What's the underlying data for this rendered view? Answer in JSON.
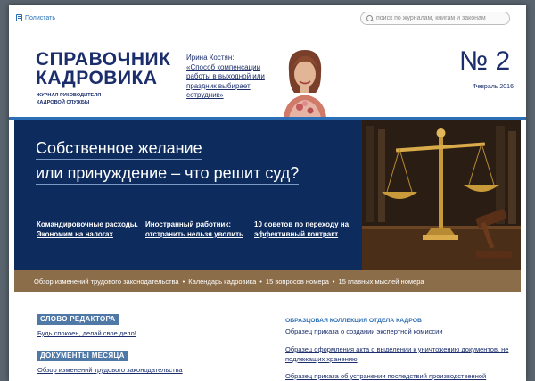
{
  "toolbar": {
    "leaf_label": "Полистать",
    "search_placeholder": "поиск по журналам, книгам и законам"
  },
  "masthead": {
    "title_line1": "СПРАВОЧНИК",
    "title_line2": "КАДРОВИКА",
    "subtitle_line1": "ЖУРНАЛ РУКОВОДИТЕЛЯ",
    "subtitle_line2": "КАДРОВОЙ СЛУЖБЫ",
    "author_name": "Ирина Костян:",
    "author_teaser": "«Способ компенсации работы в выходной или праздник выбирает сотрудник»",
    "issue_number": "№ 2",
    "issue_date": "Февраль 2016"
  },
  "hero": {
    "headline_line1": "Собственное желание",
    "headline_line2": "или принуждение – что решит суд?",
    "links": [
      {
        "text": "Командировочные расходы. Экономим на налогах"
      },
      {
        "text": "Иностранный работник: отстранить нельзя уволить"
      },
      {
        "text": "10 советов по переходу на эффективный контракт"
      }
    ]
  },
  "ticker": {
    "items": [
      "Обзор изменений трудового законодательства",
      "Календарь кадровика",
      "15 вопросов номера",
      "15 главных мыслей номера"
    ],
    "separator": "•"
  },
  "sections": {
    "editor_title": "СЛОВО РЕДАКТОРА",
    "editor_link": "Будь спокоен, делай свое дело!",
    "docs_title": "ДОКУМЕНТЫ МЕСЯЦА",
    "docs_link": "Обзор изменений трудового законодательства"
  },
  "collection": {
    "title": "ОБРАЗЦОВАЯ КОЛЛЕКЦИЯ ОТДЕЛА КАДРОВ",
    "items": [
      "Образец приказа о создании экспертной комиссии",
      "Образец оформления акта о выделении к уничтожению документов, не подлежащих хранению",
      "Образец приказа об устранении последствий производственной"
    ]
  },
  "colors": {
    "brand_navy": "#1b2e6b",
    "hero_bg": "#0d2b5c",
    "accent_blue": "#2d6fb6",
    "ticker_brown": "#8c6d4a",
    "badge_blue": "#4f78a6"
  }
}
